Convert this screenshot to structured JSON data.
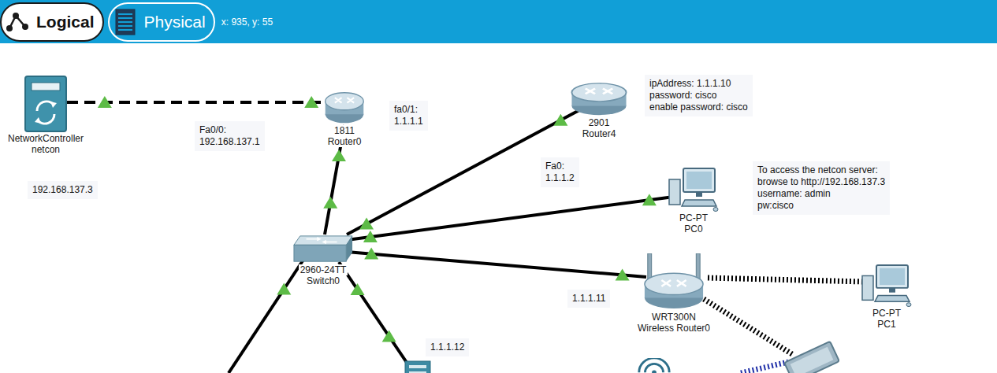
{
  "toolbar": {
    "tabs": [
      {
        "label": "Logical",
        "selected": true
      },
      {
        "label": "Physical",
        "selected": false
      }
    ],
    "coordinates": "x: 935, y: 55"
  },
  "devices": [
    {
      "kind": "controller",
      "labels": [
        "NetworkController",
        "netcon"
      ]
    },
    {
      "kind": "router",
      "labels": [
        "1811",
        "Router0"
      ]
    },
    {
      "kind": "router",
      "labels": [
        "2901",
        "Router4"
      ]
    },
    {
      "kind": "pc",
      "labels": [
        "PC-PT",
        "PC0"
      ]
    },
    {
      "kind": "switch",
      "labels": [
        "2960-24TT",
        "Switch0"
      ]
    },
    {
      "kind": "wireless-router",
      "labels": [
        "WRT300N",
        "Wireless Router0"
      ]
    },
    {
      "kind": "pc",
      "labels": [
        "PC-PT",
        "PC1"
      ]
    },
    {
      "kind": "server",
      "labels": []
    },
    {
      "kind": "access-point",
      "labels": []
    },
    {
      "kind": "laptop",
      "labels": []
    }
  ],
  "notes": [
    {
      "lines": [
        "192.168.137.3"
      ]
    },
    {
      "lines": [
        "Fa0/0:",
        "192.168.137.1"
      ]
    },
    {
      "lines": [
        "fa0/1:",
        "1.1.1.1"
      ]
    },
    {
      "lines": [
        "ipAddress: 1.1.1.10",
        "password: cisco",
        "enable password: cisco"
      ]
    },
    {
      "lines": [
        "Fa0:",
        "1.1.1.2"
      ]
    },
    {
      "lines": [
        "To access the netcon server:",
        "browse to http://192.168.137.3",
        "username: admin",
        "pw:cisco"
      ]
    },
    {
      "lines": [
        "1.1.1.11"
      ]
    },
    {
      "lines": [
        "1.1.1.12"
      ]
    }
  ],
  "links": [
    {
      "kind": "crossover",
      "up": true
    },
    {
      "kind": "straight",
      "up": true
    },
    {
      "kind": "straight",
      "up": true
    },
    {
      "kind": "straight",
      "up": true
    },
    {
      "kind": "straight",
      "up": true
    },
    {
      "kind": "straight",
      "up": true
    },
    {
      "kind": "straight",
      "up": true
    },
    {
      "kind": "wireless",
      "up": true
    },
    {
      "kind": "wireless",
      "up": true
    },
    {
      "kind": "wireless-alt",
      "up": true
    }
  ]
}
